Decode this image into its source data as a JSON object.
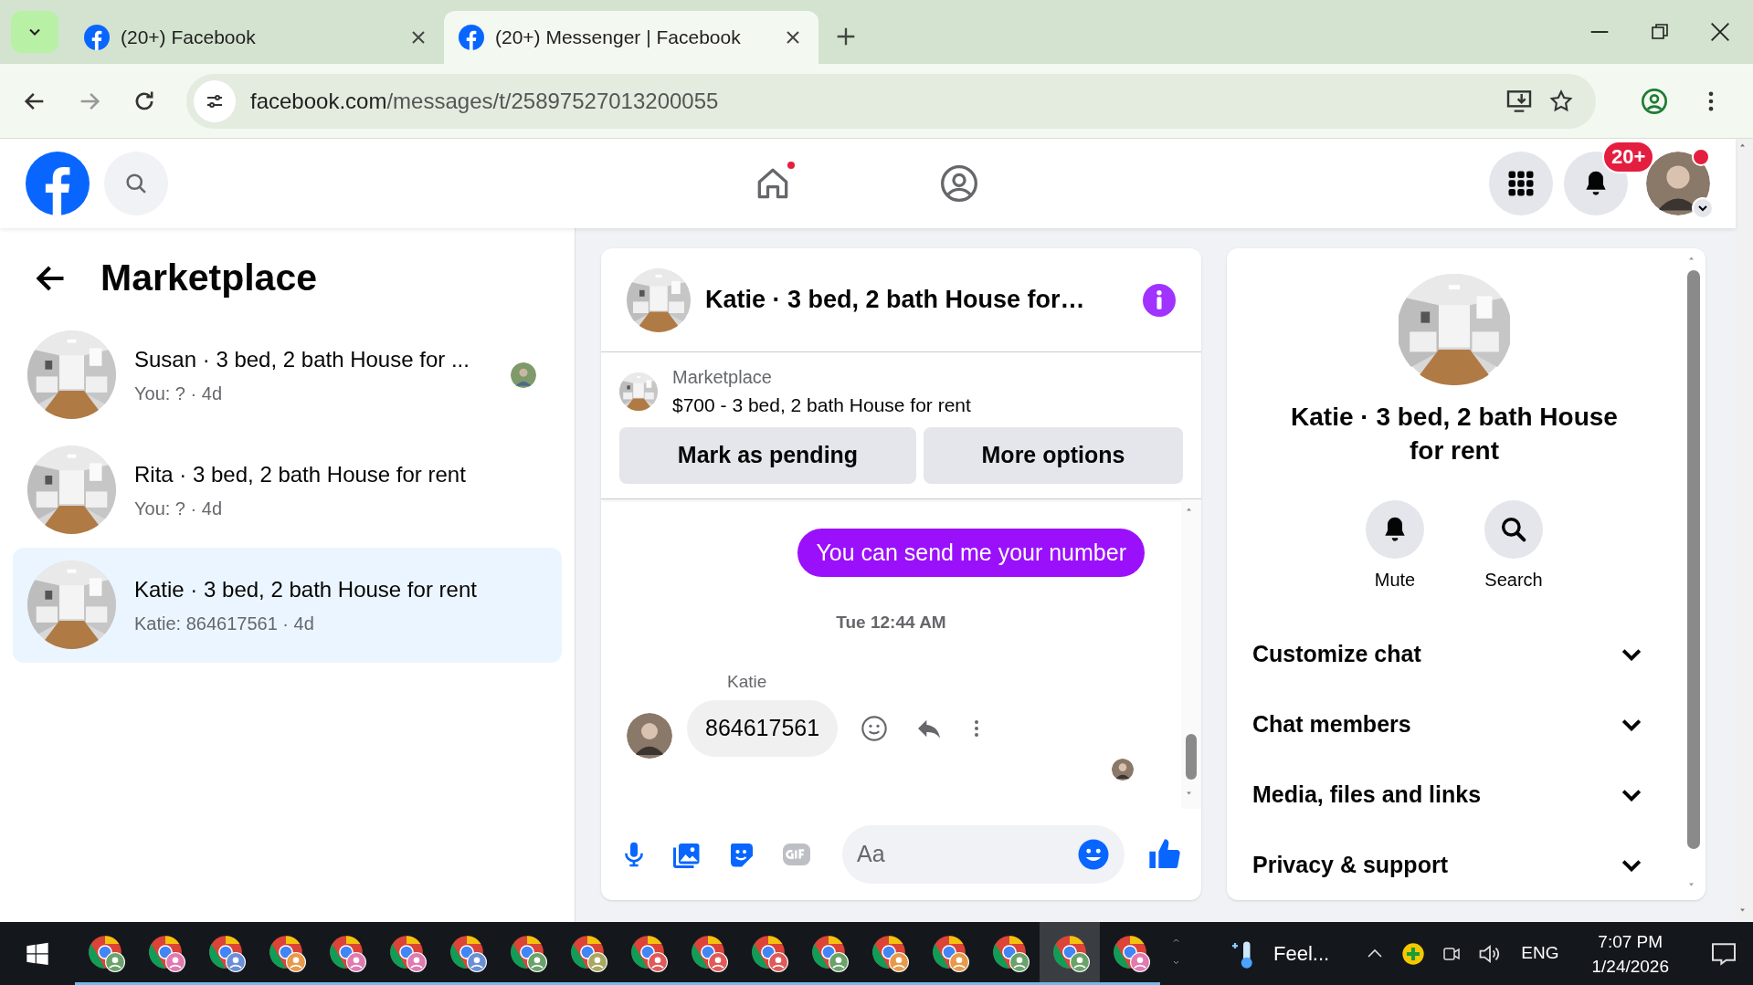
{
  "browser": {
    "tabs": [
      {
        "title": "(20+) Facebook",
        "selected": false
      },
      {
        "title": "(20+) Messenger | Facebook",
        "selected": true
      }
    ],
    "url_domain": "facebook.com",
    "url_path": "/messages/t/25897527013200055"
  },
  "header": {
    "home_notification": true,
    "notification_badge": "20+",
    "profile_online": true
  },
  "sidebar": {
    "title": "Marketplace",
    "conversations": [
      {
        "title": "Susan · 3 bed, 2 bath House for ...",
        "preview": "You: ? · 4d",
        "selected": false,
        "seen_avatar": true
      },
      {
        "title": "Rita · 3 bed, 2 bath House for rent",
        "preview": "You: ? · 4d",
        "selected": false,
        "seen_avatar": false
      },
      {
        "title": "Katie · 3 bed, 2 bath House for rent",
        "preview": "Katie: 864617561 · 4d",
        "selected": true,
        "seen_avatar": false
      }
    ]
  },
  "chat": {
    "title": "Katie · 3 bed, 2 bath House for…",
    "listing": {
      "label": "Marketplace",
      "text": "$700 - 3 bed, 2 bath House for rent"
    },
    "buttons": [
      "Mark as pending",
      "More options"
    ],
    "messages": [
      {
        "kind": "outgoing",
        "text": "You can send me your number"
      },
      {
        "kind": "timestamp",
        "text": "Tue 12:44 AM"
      },
      {
        "kind": "incoming",
        "sender": "Katie",
        "text": "864617561"
      }
    ],
    "composer": {
      "placeholder": "Aa"
    }
  },
  "details": {
    "title": "Katie · 3 bed, 2 bath House for rent",
    "actions": [
      "Mute",
      "Search"
    ],
    "sections": [
      {
        "label": "Customize chat",
        "expanded": false
      },
      {
        "label": "Chat members",
        "expanded": false
      },
      {
        "label": "Media, files and links",
        "expanded": false
      },
      {
        "label": "Privacy & support",
        "expanded": false
      }
    ]
  },
  "taskbar": {
    "apps": [
      {
        "color": "#6aa36a",
        "selected": false
      },
      {
        "color": "#e07ab0",
        "selected": false
      },
      {
        "color": "#6a8fd6",
        "selected": false
      },
      {
        "color": "#e69a4a",
        "selected": false
      },
      {
        "color": "#e07ab0",
        "selected": false
      },
      {
        "color": "#e07ab0",
        "selected": false
      },
      {
        "color": "#6a8fd6",
        "selected": false
      },
      {
        "color": "#6aa36a",
        "selected": false
      },
      {
        "color": "#a8a860",
        "selected": false
      },
      {
        "color": "#e05a5a",
        "selected": false
      },
      {
        "color": "#e05a5a",
        "selected": false
      },
      {
        "color": "#e05a5a",
        "selected": false
      },
      {
        "color": "#6aa36a",
        "selected": false
      },
      {
        "color": "#e69a4a",
        "selected": false
      },
      {
        "color": "#e69a4a",
        "selected": false
      },
      {
        "color": "#6aa36a",
        "selected": false
      },
      {
        "color": "#6aa36a",
        "selected": true
      },
      {
        "color": "#e07ab0",
        "selected": false
      }
    ],
    "weather": "Feel...",
    "language": "ENG",
    "time": "7:07 PM",
    "date": "1/24/2026"
  }
}
